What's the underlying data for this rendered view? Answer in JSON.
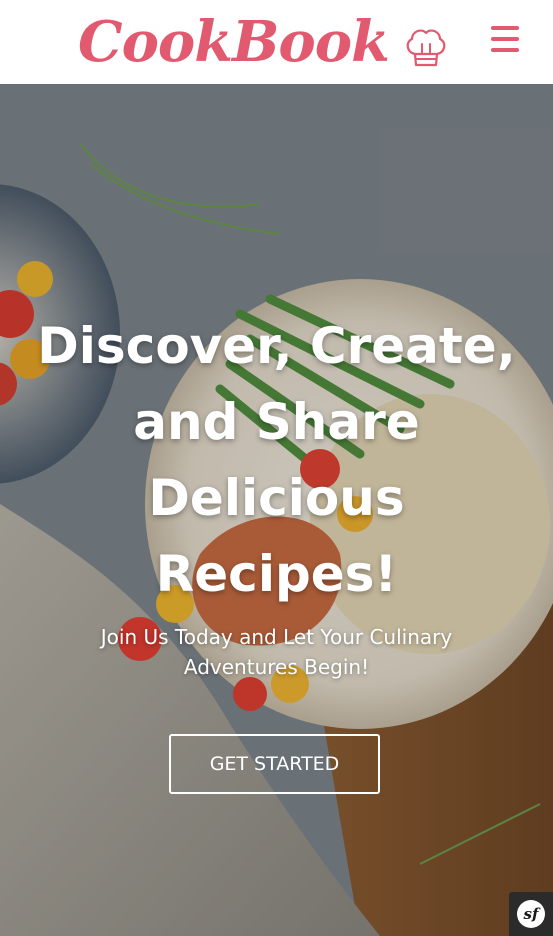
{
  "header": {
    "logo_text": "CookBook",
    "logo_icon": "chef-hat-icon",
    "menu_icon": "hamburger-menu-icon",
    "brand_color": "#e25a6f"
  },
  "hero": {
    "title": "Discover, Create, and Share Delicious Recipes!",
    "subtitle": "Join Us Today and Let Your Culinary Adventures Begin!",
    "cta_label": "GET STARTED",
    "background": "food photo: plate of couscous, green beans, tomatoes, tomato bowl and linen cloth"
  },
  "toolbar": {
    "badge_icon": "symfony-icon",
    "badge_text": "sf"
  }
}
